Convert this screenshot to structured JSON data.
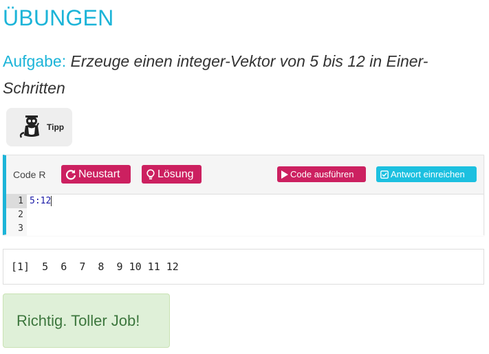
{
  "page": {
    "title": "ÜBUNGEN",
    "task_label": "Aufgabe:",
    "task_text": "Erzeuge einen integer-Vektor von 5 bis 12 in Einer-Schritten"
  },
  "hint": {
    "label": "Tipp",
    "icon": "otter-mascot-icon"
  },
  "editor": {
    "label": "Code R",
    "buttons": {
      "restart": "Neustart",
      "solution": "Lösung",
      "run": "Code ausführen",
      "submit": "Antwort einreichen"
    },
    "line_numbers": [
      "1",
      "2",
      "3"
    ],
    "code": "5:12",
    "colors": {
      "accent": "#1cb4d8",
      "red_button": "#cc2060",
      "teal_button": "#1cc0e0"
    }
  },
  "output": {
    "text": "[1]  5  6  7  8  9 10 11 12"
  },
  "feedback": {
    "message": "Richtig. Toller Job!",
    "color": "#3c763d",
    "background": "#dff0d8"
  }
}
